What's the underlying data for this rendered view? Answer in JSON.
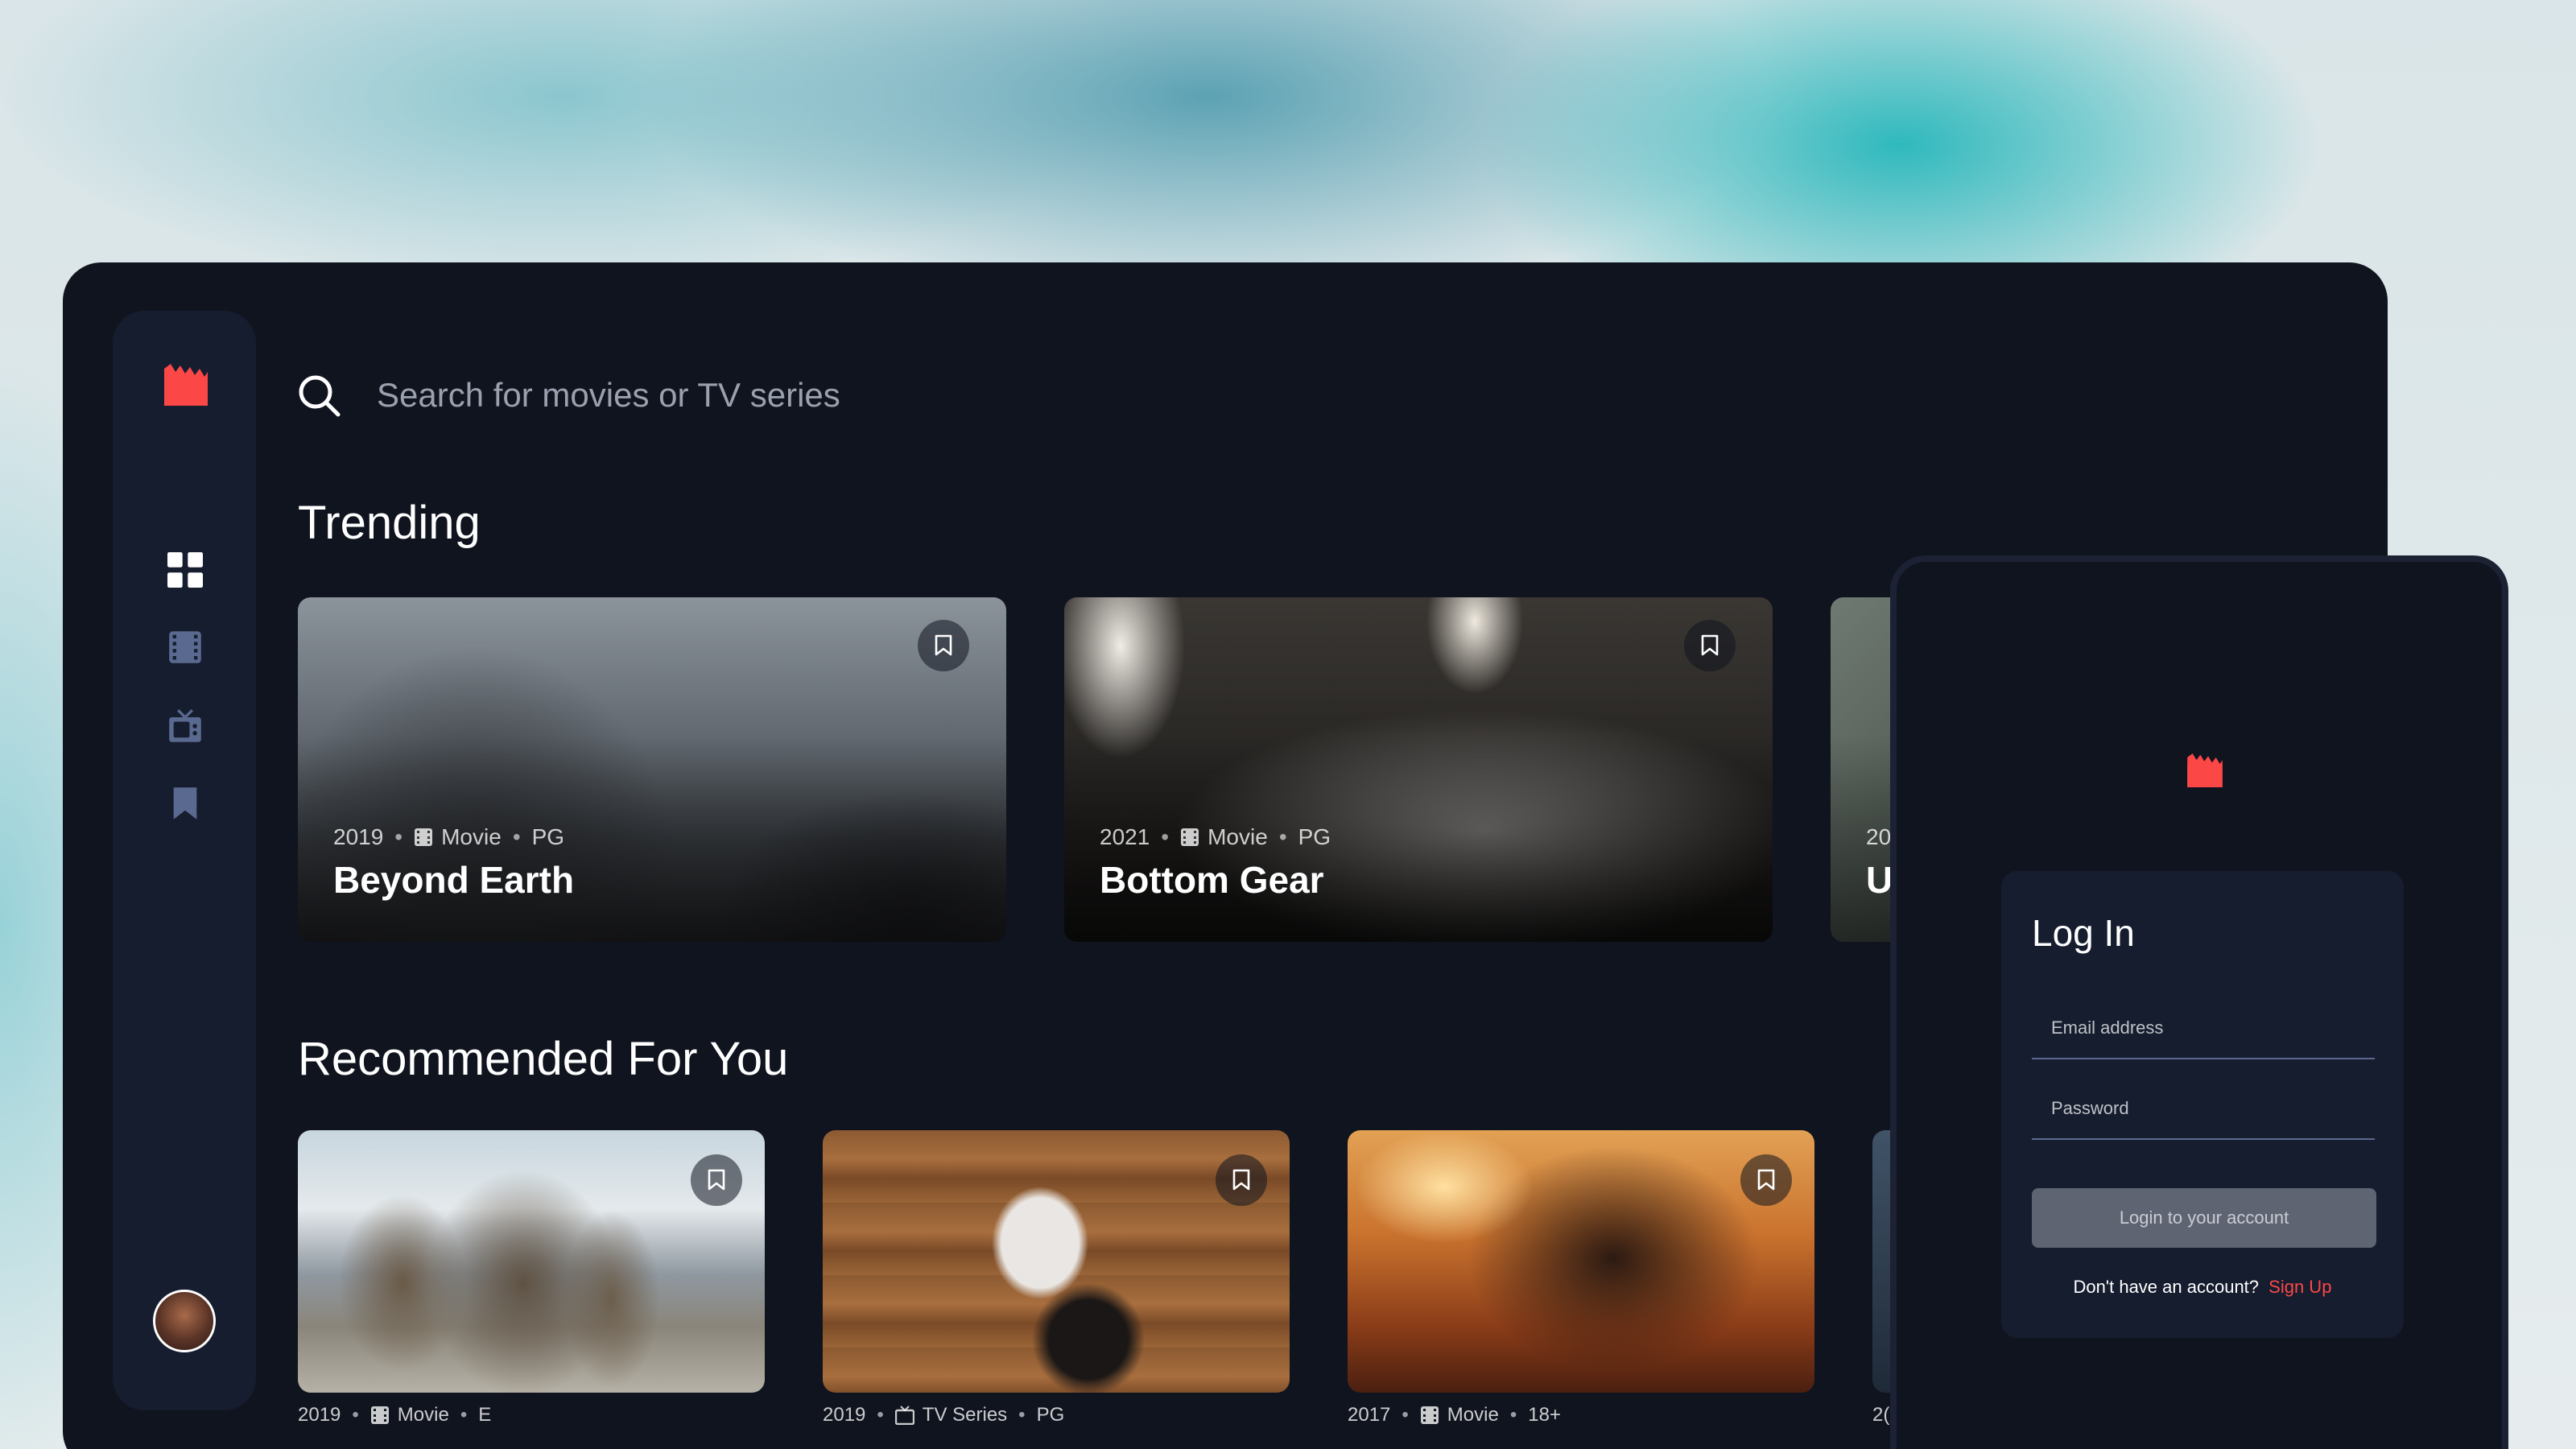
{
  "colors": {
    "accent": "#fc4747",
    "background": "#10141f",
    "surface": "#161d2f",
    "muted": "#5a698f"
  },
  "search": {
    "placeholder": "Search for movies or TV series"
  },
  "sidebar": {
    "logo_icon": "clapperboard-icon",
    "items": [
      {
        "icon": "grid-icon",
        "name": "home",
        "active": true
      },
      {
        "icon": "film-icon",
        "name": "movies",
        "active": false
      },
      {
        "icon": "tv-icon",
        "name": "tv-series",
        "active": false
      },
      {
        "icon": "bookmark-icon",
        "name": "bookmarked",
        "active": false
      }
    ]
  },
  "trending": {
    "title": "Trending",
    "items": [
      {
        "year": "2019",
        "category": "Movie",
        "rating": "PG",
        "title": "Beyond Earth"
      },
      {
        "year": "2021",
        "category": "Movie",
        "rating": "PG",
        "title": "Bottom Gear"
      },
      {
        "year": "20",
        "category": "",
        "rating": "",
        "title": "U"
      }
    ]
  },
  "recommended": {
    "title": "Recommended For You",
    "items": [
      {
        "year": "2019",
        "category": "Movie",
        "rating": "E"
      },
      {
        "year": "2019",
        "category": "TV Series",
        "rating": "PG"
      },
      {
        "year": "2017",
        "category": "Movie",
        "rating": "18+"
      },
      {
        "year": "2("
      }
    ]
  },
  "login": {
    "title": "Log In",
    "email_placeholder": "Email address",
    "password_placeholder": "Password",
    "button_label": "Login to your account",
    "signup_prompt": "Don't have an account?",
    "signup_link": "Sign Up"
  }
}
